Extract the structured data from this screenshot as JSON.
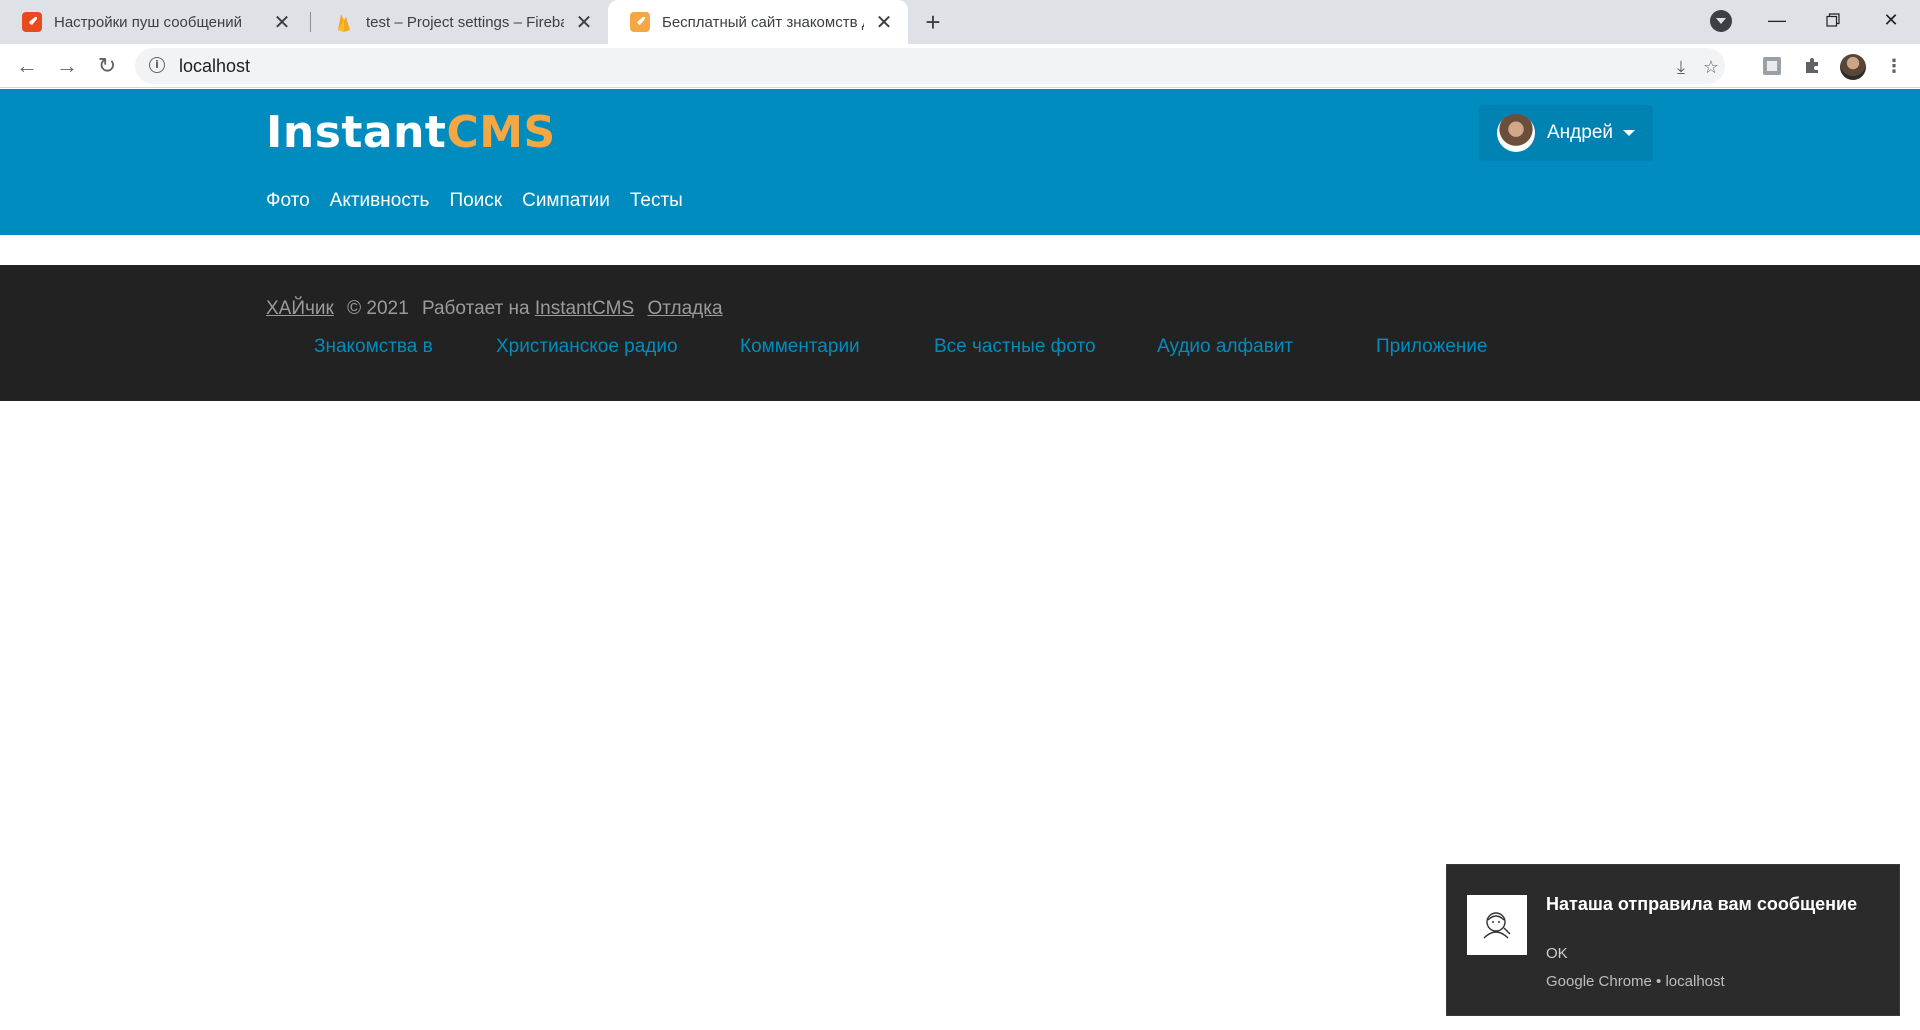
{
  "browser": {
    "tabs": [
      {
        "title": "Настройки пуш сообщений",
        "favicon": "rocket-icon",
        "favicon_color": "#e8491d"
      },
      {
        "title": "test – Project settings – Firebase",
        "favicon": "firebase-icon",
        "favicon_color": "#f5a623"
      },
      {
        "title": "Бесплатный сайт знакомств для",
        "favicon": "rocket-icon",
        "favicon_color": "#f4a742"
      }
    ],
    "url": "localhost"
  },
  "site": {
    "logo_part1": "Instant",
    "logo_part2": "CMS",
    "user_name": "Андрей",
    "nav": [
      "Фото",
      "Активность",
      "Поиск",
      "Симпатии",
      "Тесты"
    ],
    "colors": {
      "header_bg": "#008cbf",
      "logo_accent": "#f4a742",
      "footer_bg": "#222222",
      "link": "#008cbf"
    }
  },
  "footer": {
    "site_name": "ХАЙчик",
    "copyright": "© 2021",
    "powered_by": "Работает на",
    "powered_link": "InstantCMS",
    "debug_link": "Отладка",
    "links": [
      "Знакомства в",
      "Христианское радио",
      "Комментарии",
      "Все частные фото",
      "Аудио алфавит",
      "Приложение"
    ]
  },
  "notification": {
    "title": "Наташа отправила вам сообщение",
    "message": "OK",
    "source": "Google Chrome • localhost"
  }
}
